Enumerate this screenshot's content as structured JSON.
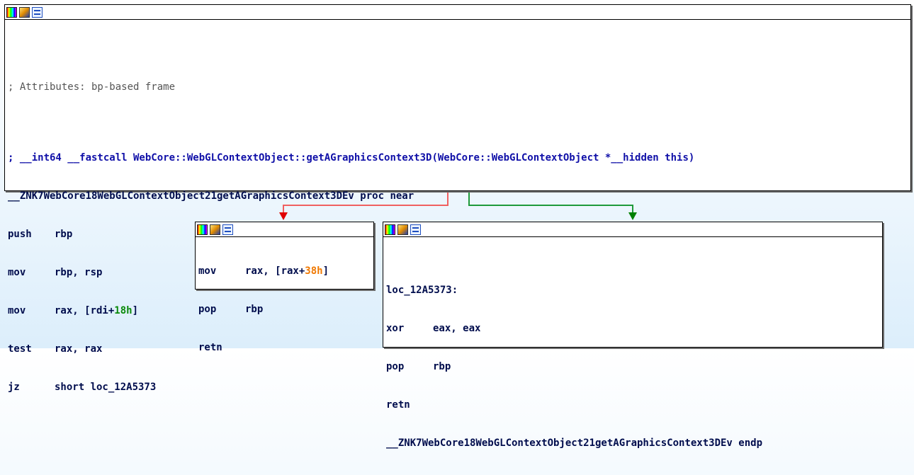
{
  "colors": {
    "edge_false": "#f06060",
    "edge_true": "#1f9a3a",
    "arrow_false": "#e00000",
    "arrow_true": "#008000"
  },
  "header_icons": [
    "color-palette-icon",
    "edit-pencil-icon",
    "graph-view-icon"
  ],
  "main_block": {
    "comment_attributes": "; Attributes: bp-based frame",
    "comment_signature": "; __int64 __fastcall WebCore::WebGLContextObject::getAGraphicsContext3D(WebCore::WebGLContextObject *__hidden this)",
    "proc_line": "__ZNK7WebCore18WebGLContextObject21getAGraphicsContext3DEv proc near",
    "instr": [
      {
        "mn": "push",
        "op": "rbp"
      },
      {
        "mn": "mov",
        "op": "rbp, rsp"
      },
      {
        "mn": "mov",
        "op_pre": "rax, [rdi+",
        "op_num": "18h",
        "op_post": "]"
      },
      {
        "mn": "test",
        "op": "rax, rax"
      },
      {
        "mn": "jz",
        "op": "short loc_12A5373"
      }
    ]
  },
  "left_block": {
    "instr": [
      {
        "mn": "mov",
        "op_pre": "rax, [rax+",
        "op_num": "38h",
        "op_post": "]"
      },
      {
        "mn": "pop",
        "op": "rbp"
      },
      {
        "mn": "retn",
        "op": ""
      }
    ]
  },
  "right_block": {
    "label": "loc_12A5373:",
    "instr": [
      {
        "mn": "xor",
        "op": "eax, eax"
      },
      {
        "mn": "pop",
        "op": "rbp"
      },
      {
        "mn": "retn",
        "op": ""
      }
    ],
    "endp_line": "__ZNK7WebCore18WebGLContextObject21getAGraphicsContext3DEv endp"
  }
}
